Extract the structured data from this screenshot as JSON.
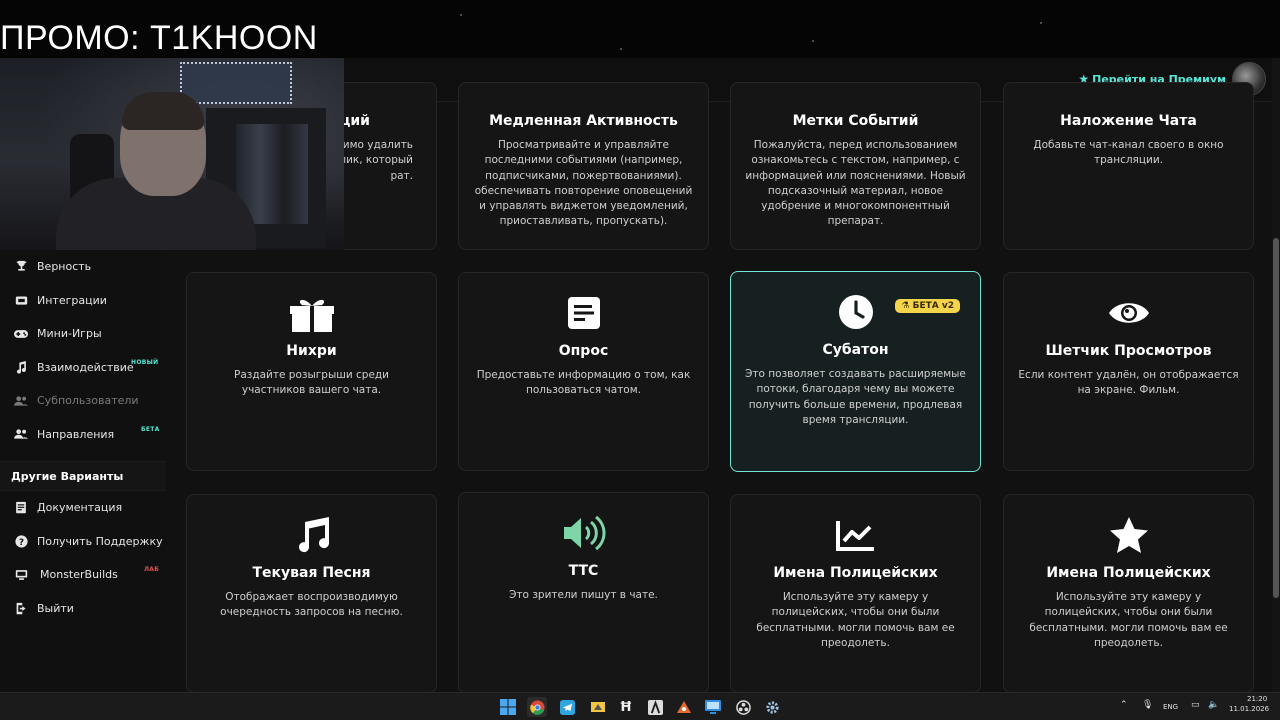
{
  "overlay": {
    "promo": "ПРОМО: T1KHOON"
  },
  "header": {
    "premium_label": "Перейти на Премиум"
  },
  "sidebar": {
    "items": [
      {
        "label": "Верность",
        "icon": "trophy-icon"
      },
      {
        "label": "Интеграции",
        "icon": "integrations-icon"
      },
      {
        "label": "Мини-Игры",
        "icon": "gamepad-icon"
      },
      {
        "label": "Взаимодействие",
        "icon": "music-note-icon",
        "badge": "НОВЫЙ"
      },
      {
        "label": "Субпользователи",
        "icon": "users-icon",
        "disabled": true
      },
      {
        "label": "Направления",
        "icon": "directions-icon",
        "badge": "БЕТА"
      }
    ],
    "section_title": "Другие Варианты",
    "other_items": [
      {
        "label": "Документация",
        "icon": "document-icon"
      },
      {
        "label": "Получить Поддержку",
        "icon": "help-icon"
      },
      {
        "label": "MonsterBuilds",
        "icon": "monitor-icon",
        "badge": "ЛАБ"
      },
      {
        "label": "Выйти",
        "icon": "logout-icon"
      }
    ]
  },
  "cards_row1": [
    {
      "title": "оций",
      "desc": "димо удалить\nлик, который\nрат."
    },
    {
      "title": "Медленная Активность",
      "desc": "Просматривайте и управляйте последними событиями (например, подписчиками, пожертвованиями). обеспечивать повторение оповещений и управлять виджетом уведомлений, приоставливать, пропускать)."
    },
    {
      "title": "Метки Событий",
      "desc": "Пожалуйста, перед использованием ознакомьтесь с текстом, например, с информацией или пояснениями. Новый подсказочный материал, новое удобрение и многокомпонентный препарат."
    },
    {
      "title": "Наложение Чата",
      "desc": "Добавьте чат-канал своего в окно трансляции."
    }
  ],
  "cards_row2": [
    {
      "title": "Нихри",
      "desc": "Раздайте розыгрыши среди участников вашего чата.",
      "icon": "gift-icon"
    },
    {
      "title": "Опрос",
      "desc": "Предоставьте информацию о том, как пользоваться чатом.",
      "icon": "poll-icon"
    },
    {
      "title": "Субатон",
      "desc": "Это позволяет создавать расширяемые потоки, благодаря чему вы можете получить больше времени, продлевая время трансляции.",
      "icon": "clock-icon",
      "badge": "БЕТА v2"
    },
    {
      "title": "Шетчик Просмотров",
      "desc": "Если контент удалён, он отображается на экране. Фильм.",
      "icon": "eye-icon"
    }
  ],
  "cards_row3": [
    {
      "title": "Текувая Песня",
      "desc": "Отображает воспроизводимую очередность запросов на песню.",
      "icon": "music-icon"
    },
    {
      "title": "TTC",
      "desc": "Это зрители пишут в чате.",
      "icon": "speaker-icon"
    },
    {
      "title": "Имена Полицейских",
      "desc": "Используйте эту камеру у полицейских, чтобы они были бесплатными. могли помочь вам ее преодолеть.",
      "icon": "chart-icon"
    },
    {
      "title": "Имена Полицейских",
      "desc": "Используйте эту камеру у полицейских, чтобы они были бесплатными. могли помочь вам ее преодолеть.",
      "icon": "star-icon"
    }
  ],
  "taskbar": {
    "lang": "ENG",
    "time": "21:20",
    "date": "11.01.2026"
  },
  "colors": {
    "accent": "#58e7d7",
    "badge_yellow": "#f4d44a",
    "card_bg": "#151515"
  }
}
